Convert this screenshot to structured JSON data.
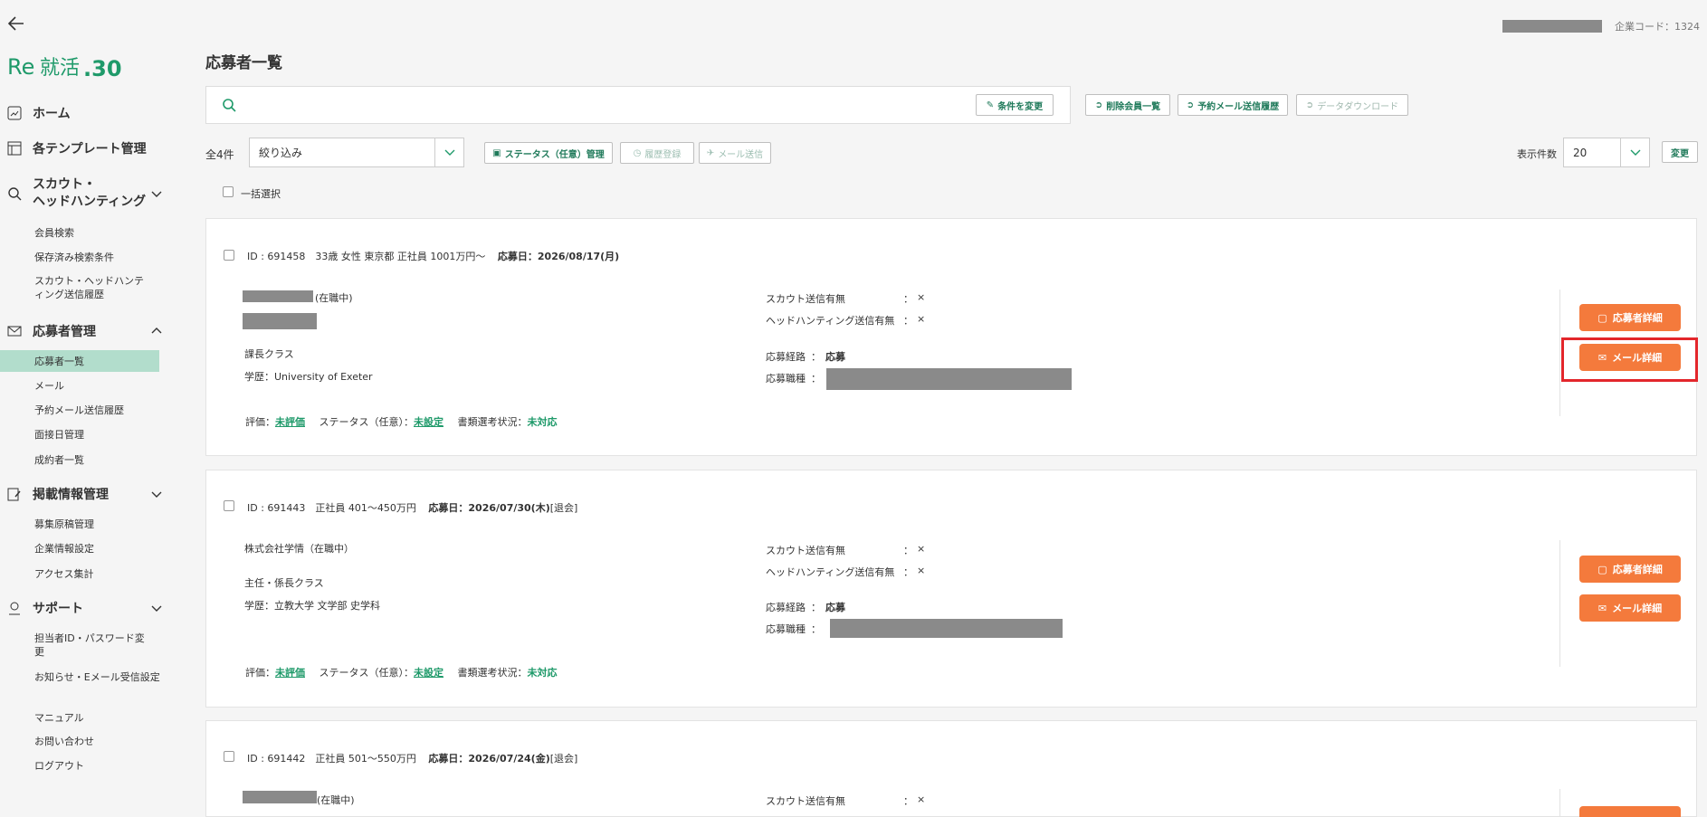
{
  "header": {
    "page_title": "応募者一覧",
    "corp_code": "企業コード：1324"
  },
  "sidebar": {
    "home": "ホーム",
    "templates": "各テンプレート管理",
    "scout_line1": "スカウト・",
    "scout_line2": "ヘッドハンティング",
    "scout_items": [
      "会員検索",
      "保存済み検索条件",
      "スカウト・ヘッドハンティング送信履歴"
    ],
    "applicants": "応募者管理",
    "applicant_items": [
      "応募者一覧",
      "メール",
      "予約メール送信履歴",
      "面接日管理",
      "成約者一覧"
    ],
    "listing": "掲載情報管理",
    "listing_items": [
      "募集原稿管理",
      "企業情報設定",
      "アクセス集計"
    ],
    "support": "サポート",
    "support_items": [
      "担当者ID・パスワード変更",
      "お知らせ・Eメール受信設定",
      "マニュアル",
      "お問い合わせ",
      "ログアウト"
    ]
  },
  "search": {
    "placeholder": "",
    "change_cond": "条件を変更",
    "deleted_members": "削除会員一覧",
    "reserved_mail_history": "予約メール送信履歴",
    "data_download": "データダウンロード"
  },
  "toolbar": {
    "total": "全4件",
    "filter_value": "絞り込み",
    "status_manage": "ステータス（任意）管理",
    "history_register": "履歴登録",
    "mail_send": "メール送信",
    "per_page_label": "表示件数",
    "per_page_value": "20",
    "change_btn": "変更",
    "bulk_select": "一括選択"
  },
  "labels": {
    "scout_sent": "スカウト送信有無",
    "headhunt_sent": "ヘッドハンティング送信有無",
    "route": "応募経路",
    "job": "応募職種",
    "colon": "：",
    "cross": "×",
    "eval": "評価：",
    "status": "ステータス（任意）：",
    "doc_status": "書類選考状況：",
    "btn_detail": "応募者詳細",
    "btn_mail": "メール詳細"
  },
  "cards": [
    {
      "head": "ID : 691458　33歳 女性 東京都 正社員 1001万円〜",
      "date": "応募日：2026/08/17(月)",
      "status_note": "",
      "employment": "(在職中)",
      "position": "課長クラス",
      "education": "学歴：University of Exeter",
      "route_value": "応募",
      "eval_value": "未評価",
      "status_value": "未設定",
      "doc_value": "未対応"
    },
    {
      "head": "ID : 691443　正社員 401〜450万円",
      "date": "応募日：2026/07/30(木)",
      "status_note": "[退会]",
      "employment": "株式会社学情（在職中）",
      "position": "主任・係長クラス",
      "education": "学歴：立教大学 文学部 史学科",
      "route_value": "応募",
      "eval_value": "未評価",
      "status_value": "未設定",
      "doc_value": "未対応"
    },
    {
      "head": "ID : 691442　正社員 501〜550万円",
      "date": "応募日：2026/07/24(金)",
      "status_note": "[退会]",
      "employment": "(在職中)"
    }
  ],
  "colors": {
    "accent": "#1f9a6a",
    "orange": "#f47a3c",
    "highlight": "#e3262b",
    "active_nav": "#b2ddcc"
  }
}
